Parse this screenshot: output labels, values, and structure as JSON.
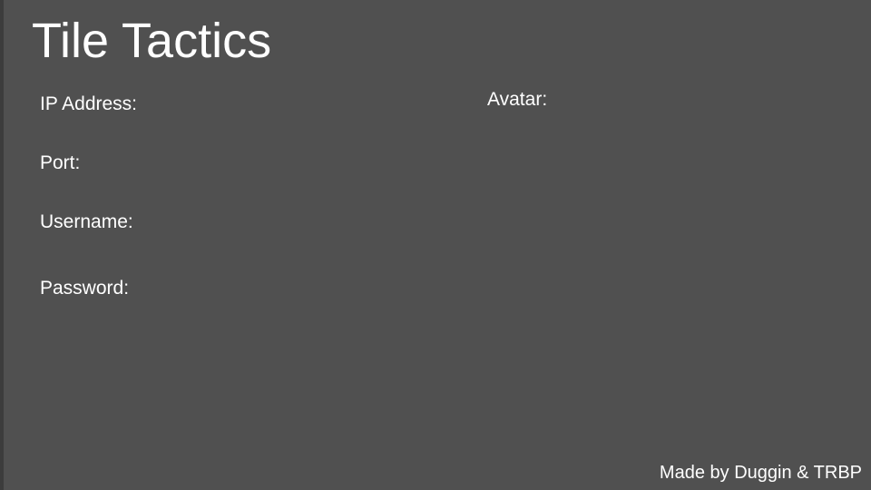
{
  "title": "Tile Tactics",
  "form": {
    "ip_label": "IP Address:",
    "port_label": "Port:",
    "username_label": "Username:",
    "password_label": "Password:"
  },
  "avatar": {
    "label": "Avatar:"
  },
  "footer": {
    "credits": "Made by Duggin & TRBP"
  },
  "colors": {
    "background": "#505050",
    "text": "#ffffff",
    "left_edge": "#3c3c3c"
  }
}
